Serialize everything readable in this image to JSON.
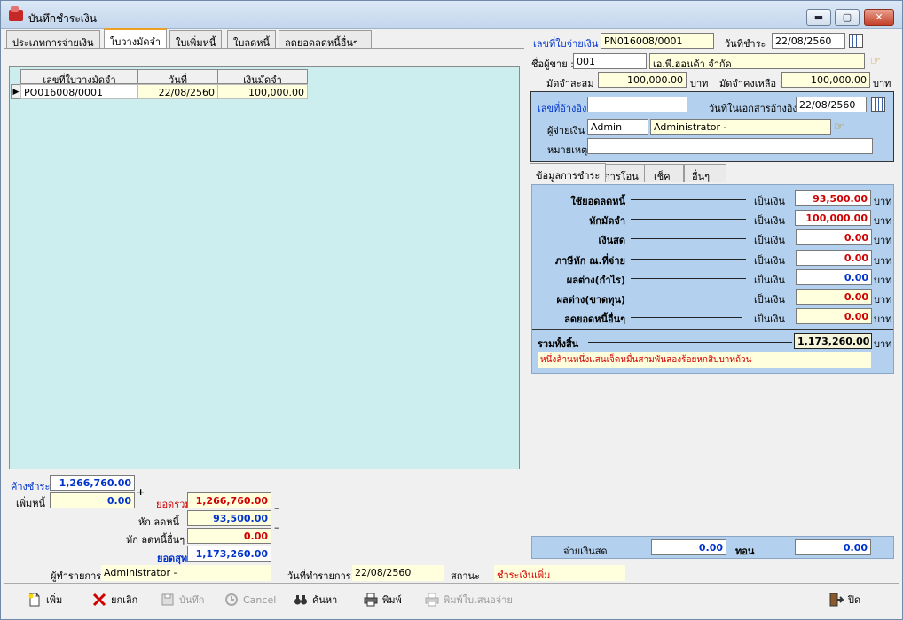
{
  "window": {
    "title": "บันทึกชำระเงิน",
    "min": "▬",
    "max": "▢",
    "close": "✕"
  },
  "tabs": [
    "ประเภทการจ่ายเงิน",
    "ใบวางมัดจำ",
    "ใบเพิ่มหนี้",
    "ใบลดหนี้",
    "ลดยอดลดหนี้อื่นๆ"
  ],
  "grid": {
    "headers": [
      "เลขที่ใบวางมัดจำ",
      "วันที่",
      "เงินมัดจำ"
    ],
    "rows": [
      [
        "PO016008/0001",
        "22/08/2560",
        "100,000.00"
      ]
    ],
    "row_marker": "▶"
  },
  "header": {
    "doc_no_label": "เลขที่ใบจ่ายเงิน",
    "doc_no": "PN016008/0001",
    "pay_date_label": "วันที่ชำระ",
    "pay_date": "22/08/2560",
    "seller_label": "ชื่อผู้ขาย :",
    "seller_code": "001",
    "seller_name": "เอ.พี.ฮอนด้า จำกัด",
    "deposit_total_label": "มัดจำสะสม :",
    "deposit_total": "100,000.00",
    "baht1": "บาท",
    "deposit_remain_label": "มัดจำคงเหลือ :",
    "deposit_remain": "100,000.00",
    "baht2": "บาท"
  },
  "ref": {
    "ref_no_label": "เลขที่อ้างอิง",
    "ref_no": "",
    "ref_date_label": "วันที่ในเอกสารอ้างอิง",
    "ref_date": "22/08/2560",
    "payer_label": "ผู้จ่ายเงิน",
    "payer_code": "Admin",
    "payer_name": "Administrator -",
    "note_label": "หมายเหตุ",
    "note": ""
  },
  "subtabs": [
    "ข้อมูลการชำระ",
    "การโอน",
    "เช็ค",
    "อื่นๆ"
  ],
  "payment": {
    "rows": [
      {
        "label": "ใช้ยอดลดหนี้",
        "unit": "เป็นเงิน",
        "value": "93,500.00",
        "baht": "บาท"
      },
      {
        "label": "หักมัดจำ",
        "unit": "เป็นเงิน",
        "value": "100,000.00",
        "baht": "บาท"
      },
      {
        "label": "เงินสด",
        "unit": "เป็นเงิน",
        "value": "0.00",
        "baht": "บาท"
      },
      {
        "label": "ภาษีหัก ณ.ที่จ่าย",
        "unit": "เป็นเงิน",
        "value": "0.00",
        "baht": "บาท"
      },
      {
        "label": "ผลต่าง(กำไร)",
        "unit": "เป็นเงิน",
        "value": "0.00",
        "baht": "บาท"
      },
      {
        "label": "ผลต่าง(ขาดทุน)",
        "unit": "เป็นเงิน",
        "value": "0.00",
        "baht": "บาท"
      },
      {
        "label": "ลดยอดหนี้อื่นๆ",
        "unit": "เป็นเงิน",
        "value": "0.00",
        "baht": "บาท"
      }
    ],
    "total_label": "รวมทั้งสิ้น",
    "total": "1,173,260.00",
    "total_baht": "บาท",
    "amount_text": "หนึ่งล้านหนึ่งแสนเจ็ดหมื่นสามพันสองร้อยหกสิบบาทถ้วน",
    "cash_paid_label": "จ่ายเงินสด",
    "cash_paid": "0.00",
    "change_label": "ทอน",
    "change": "0.00"
  },
  "summary": {
    "outstanding_label": "ค้างชำระ",
    "outstanding": "1,266,760.00",
    "plus": "+",
    "add_debt_label": "เพิ่มหนี้",
    "add_debt": "0.00",
    "sum_label": "ยอดรวม",
    "sum": "1,266,760.00",
    "minus1": "–",
    "less_credit_label": "หัก ลดหนี้",
    "less_credit": "93,500.00",
    "less_other_label": "หัก ลดหนี้อื่นๆ",
    "less_other": "0.00",
    "minus2": "–",
    "net_label": "ยอดสุทธิ",
    "net": "1,173,260.00"
  },
  "footer": {
    "user_label": "ผู้ทำรายการ",
    "user": "Administrator -",
    "date_label": "วันที่ทำรายการ",
    "date": "22/08/2560",
    "status_label": "สถานะ",
    "status": "ชำระเงินเพิ่ม"
  },
  "toolbar": {
    "add": "เพิ่ม",
    "cancel": "ยกเลิก",
    "save": "บันทึก",
    "cancel_en": "Cancel",
    "search": "ค้นหา",
    "print": "พิมพ์",
    "print_offer": "พิมพ์ใบเสนอจ่าย",
    "close": "ปิด"
  },
  "colors": {
    "accent_red": "#d00000",
    "accent_blue": "#0033cc",
    "grid_bg": "#cceeee",
    "panel_bg": "#b3d1ee",
    "yellow_field": "#ffffdd"
  }
}
